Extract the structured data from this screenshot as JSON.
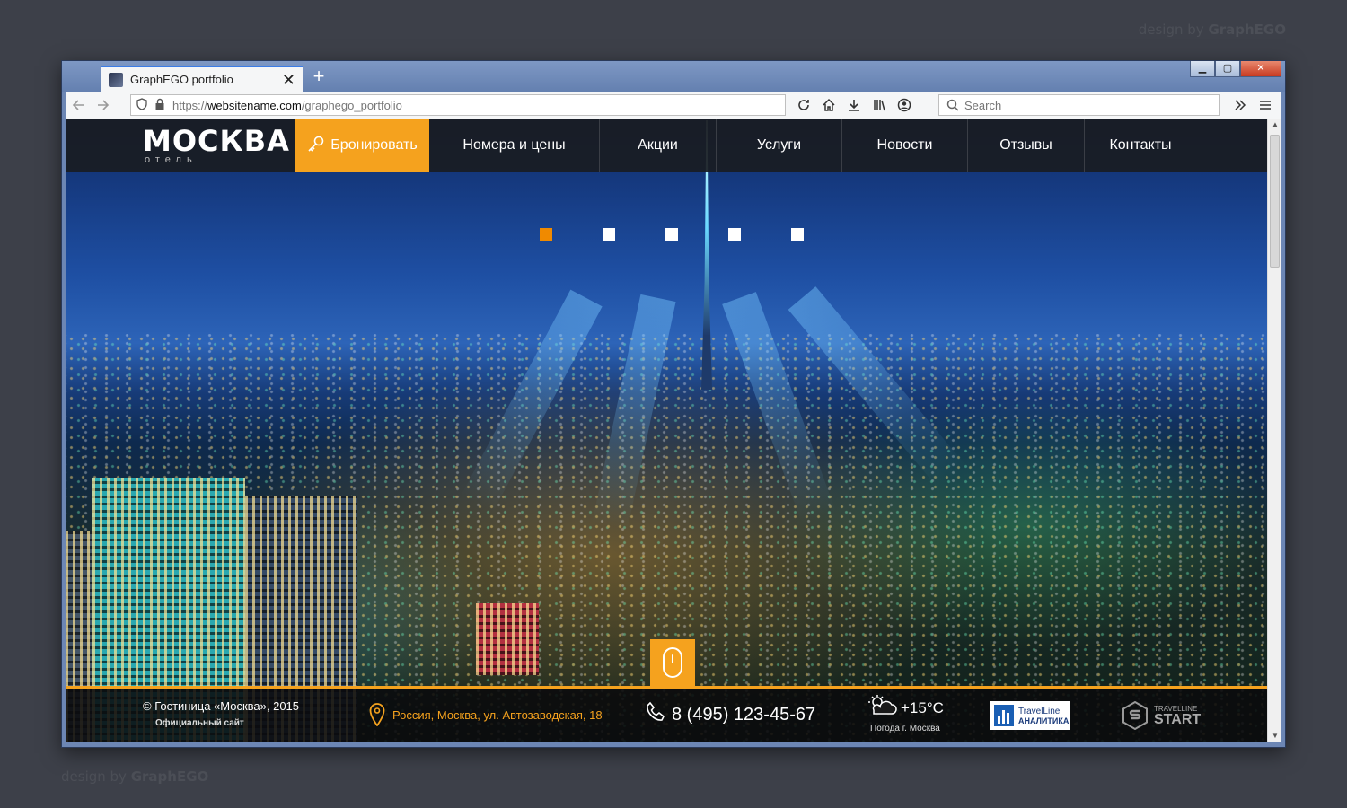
{
  "watermark": {
    "prefix": "design by ",
    "brand": "GraphEGO"
  },
  "browser": {
    "tab_title": "GraphEGO portfolio",
    "tab_close": "✕",
    "new_tab": "+",
    "url_scheme": "https://",
    "url_host": "websitename.com",
    "url_path": "/graphego_portfolio",
    "search_placeholder": "Search",
    "win_min": "▁",
    "win_max": "▢",
    "win_close": "✕"
  },
  "site": {
    "logo_title": "МОСКВА",
    "logo_sub": "отель",
    "book_label": "Бронировать",
    "menu": [
      {
        "label": "Номера и цены"
      },
      {
        "label": "Акции"
      },
      {
        "label": "Услуги"
      },
      {
        "label": "Новости"
      },
      {
        "label": "Отзывы"
      },
      {
        "label": "Контакты"
      }
    ],
    "slider_active_index": 0,
    "slider_count": 5
  },
  "footer": {
    "copyright": "© Гостиница «Москва», 2015",
    "official": "Официальный сайт",
    "address": "Россия, Москва, ул. Автозаводская, 18",
    "phone": "8 (495) 123-45-67",
    "temperature": "+15°C",
    "weather_caption": "Погода г. Москва",
    "tl_badge_line1": "TravelLine",
    "tl_badge_line2": "АНАЛИТИКА",
    "tl_start_small": "TRAVELLINE",
    "tl_start_big": "START"
  },
  "colors": {
    "accent": "#f5a21e",
    "header_bg": "#191c22",
    "active_dot": "#f08a00"
  }
}
